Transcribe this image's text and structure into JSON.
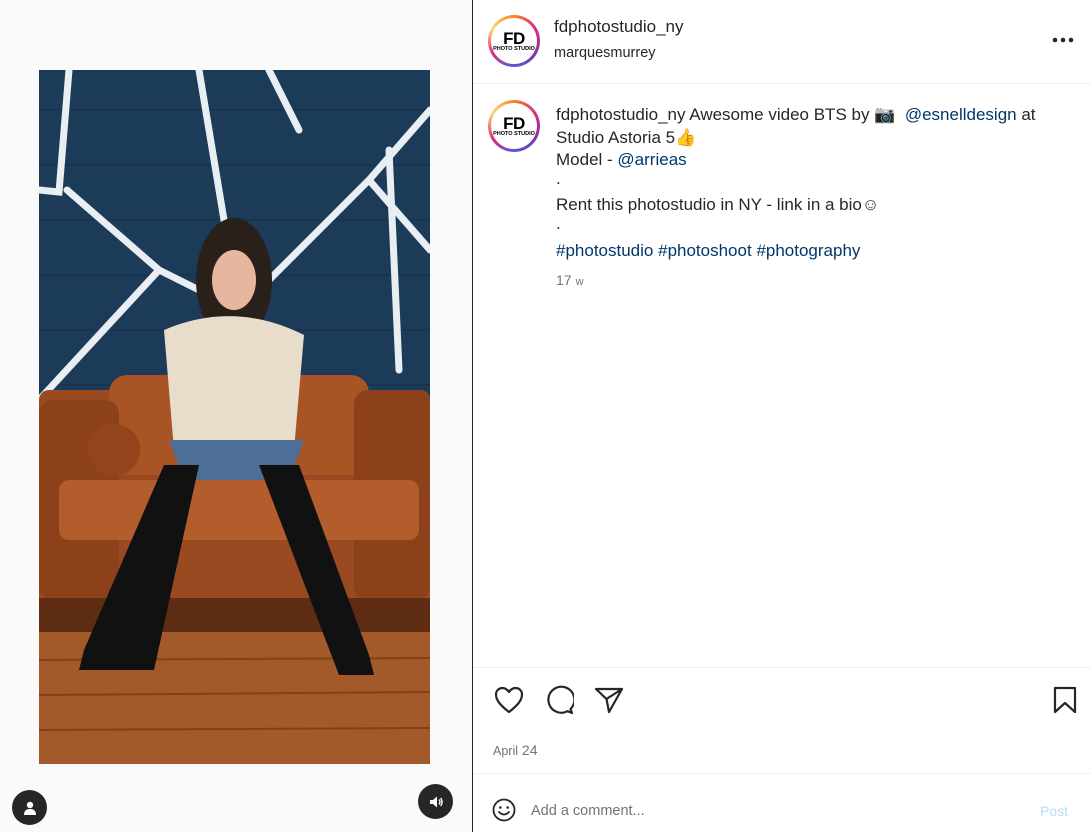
{
  "header": {
    "username": "fdphotostudio_ny",
    "subtitle": "marquesmurrey",
    "avatar_text_top": "FD",
    "avatar_text_bottom": "PHOTO STUDIO"
  },
  "caption": {
    "username": "fdphotostudio_ny",
    "text_1": "Awesome video BTS by",
    "camera_emoji": "📷",
    "mention_1": "@esnelldesign",
    "text_2": "at",
    "text_3": "Studio Astoria 5",
    "thumbs_emoji": "👍",
    "text_4": "Model -",
    "mention_2": "@arrieas",
    "dot": ".",
    "text_5": "Rent this photostudio in NY - link in a bio",
    "smile_emoji": "☺",
    "hashtag_1": "#photostudio",
    "hashtag_2": "#photoshoot",
    "hashtag_3": "#photography",
    "time_num": "17",
    "time_unit": "w"
  },
  "footer": {
    "date_month": "April",
    "date_day": "24",
    "comment_placeholder": "Add a comment...",
    "post_label": "Post"
  },
  "icons": {
    "more": "more-horizontal-icon",
    "like": "heart-icon",
    "comment": "comment-bubble-icon",
    "share": "paper-plane-icon",
    "save": "bookmark-icon",
    "emoji": "smiley-icon",
    "tags": "user-icon",
    "audio": "speaker-icon"
  },
  "colors": {
    "link": "#00376b",
    "muted": "#737373",
    "post_disabled": "#b2dffc"
  }
}
